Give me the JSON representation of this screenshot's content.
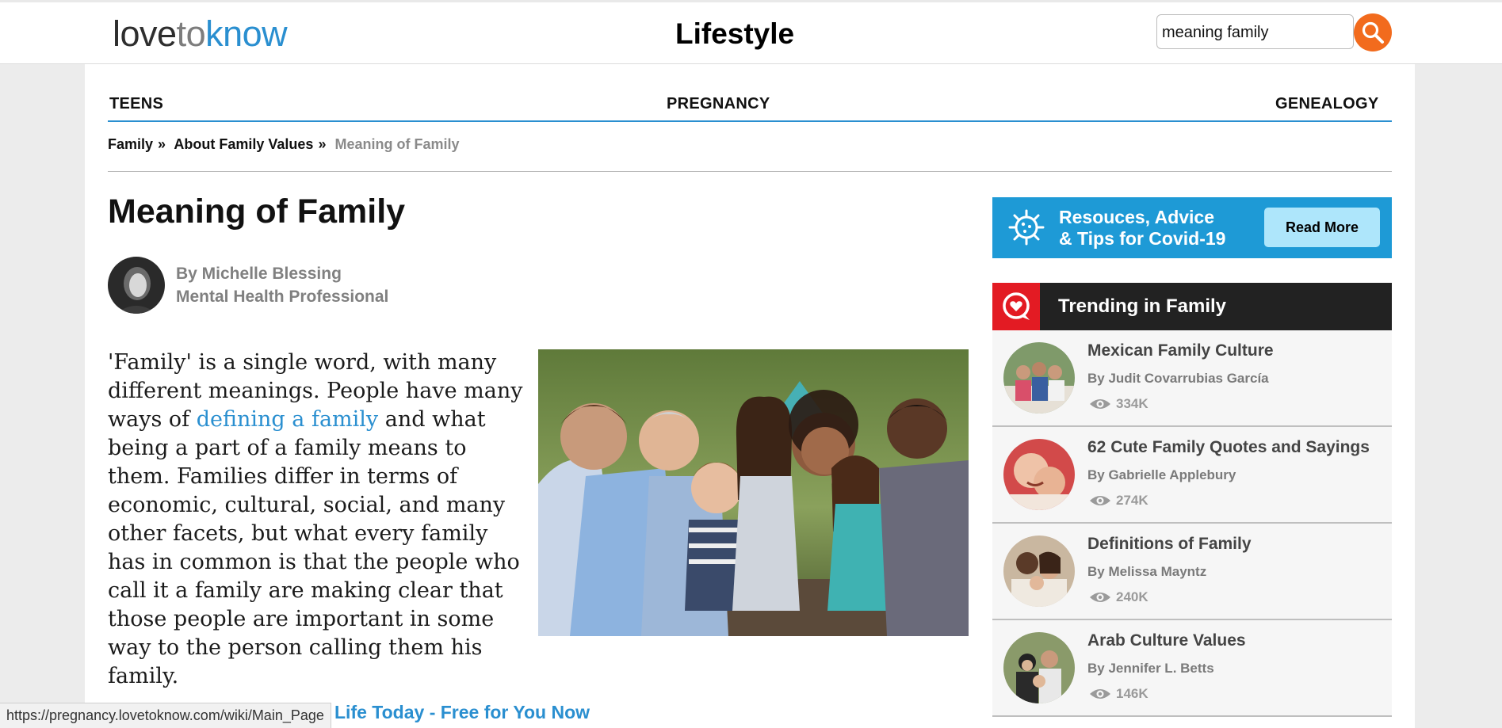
{
  "header": {
    "logo": {
      "part1": "love",
      "part2": "to",
      "part3": "know"
    },
    "section_title": "Lifestyle",
    "search": {
      "value": "meaning family",
      "icon": "search-icon"
    }
  },
  "nav": {
    "items": [
      {
        "label": "TEENS"
      },
      {
        "label": "PREGNANCY"
      },
      {
        "label": "GENEALOGY"
      }
    ]
  },
  "breadcrumb": {
    "items": [
      {
        "label": "Family"
      },
      {
        "label": "About Family Values"
      }
    ],
    "separator": "»",
    "current": "Meaning of Family"
  },
  "article": {
    "title": "Meaning of Family",
    "author": {
      "name": "By Michelle Blessing",
      "role": "Mental Health Professional"
    },
    "body": {
      "before_link": "'Family' is a single word, with many different meanings. People have many ways of ",
      "link": "defining a family",
      "after_link": " and what being a part of a family means to them. Families differ in terms of economic, cultural, social, and many other facets, but what every family has in common is that the people who call it a family are making clear that those people are important in some way to the person calling them his family."
    },
    "promo_text": "Life Today - Free for You Now"
  },
  "status_url": "https://pregnancy.lovetoknow.com/wiki/Main_Page",
  "sidebar": {
    "covid": {
      "line1": "Resouces, Advice",
      "line2": "& Tips for Covid-19",
      "button": "Read More"
    },
    "trending": {
      "title": "Trending in Family",
      "items": [
        {
          "title": "Mexican Family Culture",
          "author": "By Judit Covarrubias García",
          "views": "334K"
        },
        {
          "title": "62 Cute Family Quotes and Sayings",
          "author": "By Gabrielle Applebury",
          "views": "274K"
        },
        {
          "title": "Definitions of Family",
          "author": "By Melissa Mayntz",
          "views": "240K"
        },
        {
          "title": "Arab Culture Values",
          "author": "By Jennifer L. Betts",
          "views": "146K"
        }
      ]
    }
  },
  "colors": {
    "brand_blue": "#2a8fd0",
    "search_orange": "#f26b1d",
    "trending_red": "#e31b23",
    "covid_blue": "#1e9ad6"
  }
}
